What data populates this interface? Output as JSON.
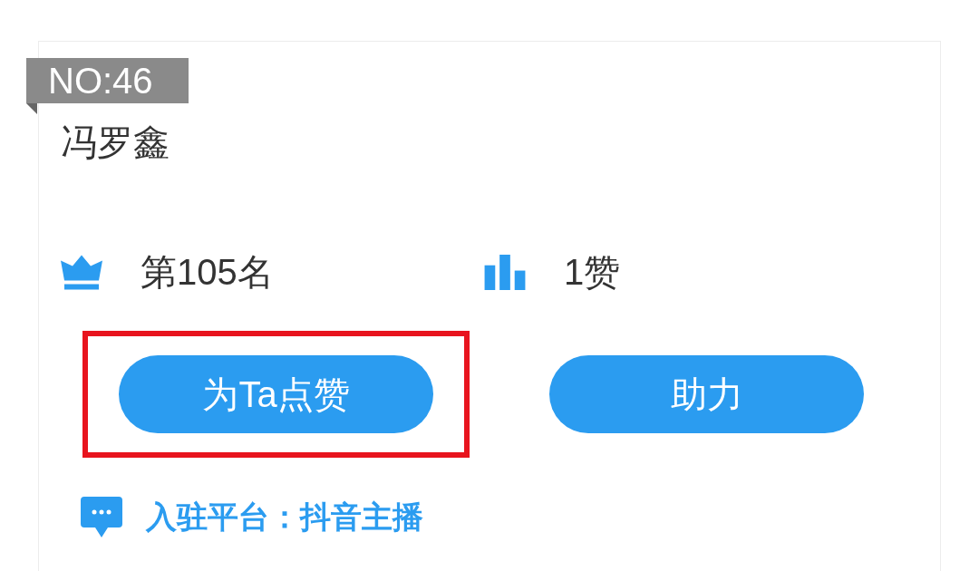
{
  "badge": "NO:46",
  "name": "冯罗鑫",
  "stats": [
    {
      "kind": "rank",
      "text": "第105名"
    },
    {
      "kind": "likes",
      "text": "1赞"
    }
  ],
  "buttons": [
    {
      "label": "为Ta点赞",
      "highlighted": true
    },
    {
      "label": "助力",
      "highlighted": false
    }
  ],
  "footer": {
    "text": "入驻平台：抖音主播"
  }
}
